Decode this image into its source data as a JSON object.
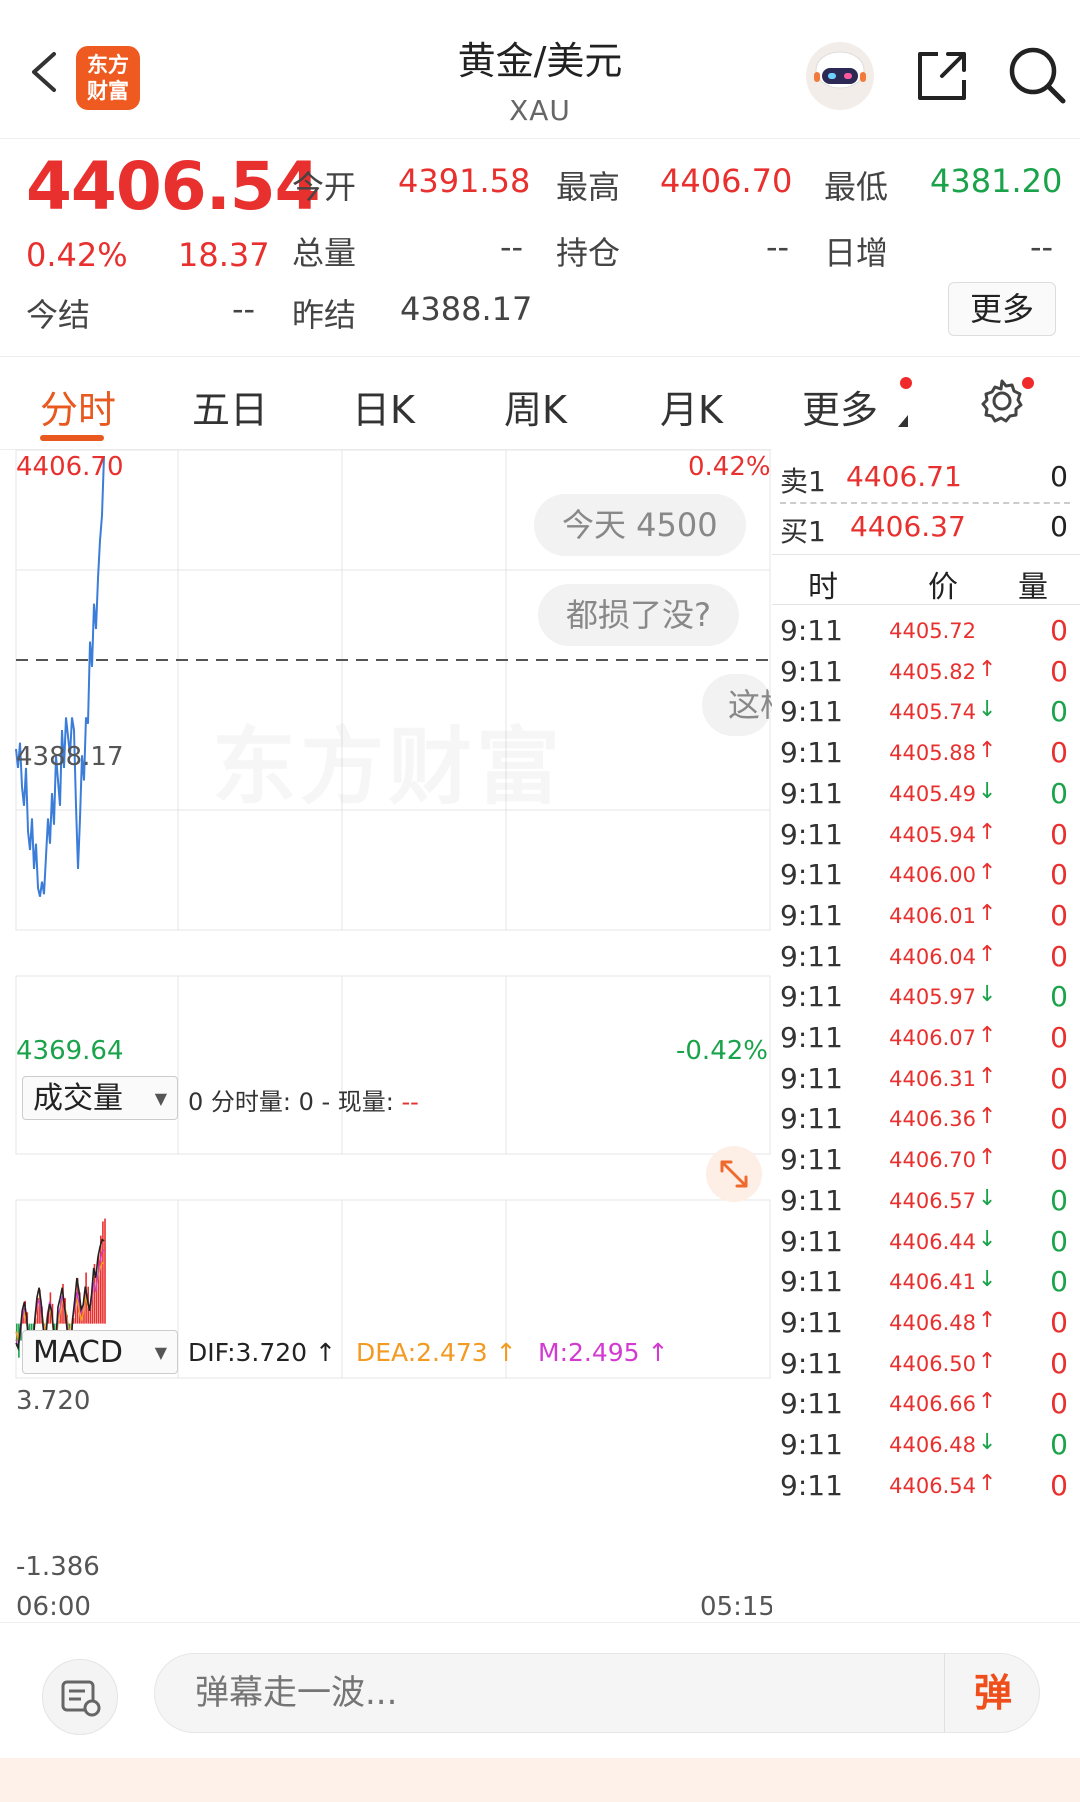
{
  "header": {
    "title": "黄金/美元",
    "subtitle": "XAU",
    "logo_text_line1": "东方",
    "logo_text_line2": "财富"
  },
  "quote": {
    "price": "4406.54",
    "change_pct": "0.42%",
    "change": "18.37",
    "open_label": "今开",
    "open": "4391.58",
    "high_label": "最高",
    "high": "4406.70",
    "low_label": "最低",
    "low": "4381.20",
    "volume_label": "总量",
    "volume": "--",
    "position_label": "持仓",
    "position": "--",
    "daily_inc_label": "日增",
    "daily_inc": "--",
    "settle_label": "今结",
    "settle": "--",
    "prev_settle_label": "昨结",
    "prev_settle": "4388.17",
    "more_label": "更多"
  },
  "tabs": [
    {
      "label": "分时"
    },
    {
      "label": "五日"
    },
    {
      "label": "日K"
    },
    {
      "label": "周K"
    },
    {
      "label": "月K"
    },
    {
      "label": "更多"
    }
  ],
  "chart": {
    "top_price": "4406.70",
    "top_pct": "0.42%",
    "mid_price": "4388.17",
    "bottom_price": "4369.64",
    "bottom_pct": "-0.42%",
    "watermark": "东方财富",
    "bubbles": [
      "今天 4500",
      "都损了没?",
      "这株"
    ],
    "volume_selector": "成交量",
    "volume_info": "0 分时量: 0 - 现量: ",
    "volume_now": "--",
    "macd_selector": "MACD",
    "dif": "DIF:3.720 ↑",
    "dea": "DEA:2.473 ↑",
    "m": "M:2.495 ↑",
    "macd_top": "3.720",
    "macd_bottom": "-1.386",
    "time_start": "06:00",
    "time_end": "05:15"
  },
  "orderbook": {
    "sell_label": "卖1",
    "sell_price": "4406.71",
    "sell_vol": "0",
    "buy_label": "买1",
    "buy_price": "4406.37",
    "buy_vol": "0",
    "col_time": "时",
    "col_price": "价",
    "col_vol": "量"
  },
  "ticks": [
    {
      "t": "9:11",
      "p": "4405.72",
      "a": "",
      "v": "0",
      "c": "red"
    },
    {
      "t": "9:11",
      "p": "4405.82",
      "a": "↑",
      "v": "0",
      "c": "red"
    },
    {
      "t": "9:11",
      "p": "4405.74",
      "a": "↓",
      "v": "0",
      "c": "green"
    },
    {
      "t": "9:11",
      "p": "4405.88",
      "a": "↑",
      "v": "0",
      "c": "red"
    },
    {
      "t": "9:11",
      "p": "4405.49",
      "a": "↓",
      "v": "0",
      "c": "green"
    },
    {
      "t": "9:11",
      "p": "4405.94",
      "a": "↑",
      "v": "0",
      "c": "red"
    },
    {
      "t": "9:11",
      "p": "4406.00",
      "a": "↑",
      "v": "0",
      "c": "red"
    },
    {
      "t": "9:11",
      "p": "4406.01",
      "a": "↑",
      "v": "0",
      "c": "red"
    },
    {
      "t": "9:11",
      "p": "4406.04",
      "a": "↑",
      "v": "0",
      "c": "red"
    },
    {
      "t": "9:11",
      "p": "4405.97",
      "a": "↓",
      "v": "0",
      "c": "green"
    },
    {
      "t": "9:11",
      "p": "4406.07",
      "a": "↑",
      "v": "0",
      "c": "red"
    },
    {
      "t": "9:11",
      "p": "4406.31",
      "a": "↑",
      "v": "0",
      "c": "red"
    },
    {
      "t": "9:11",
      "p": "4406.36",
      "a": "↑",
      "v": "0",
      "c": "red"
    },
    {
      "t": "9:11",
      "p": "4406.70",
      "a": "↑",
      "v": "0",
      "c": "red"
    },
    {
      "t": "9:11",
      "p": "4406.57",
      "a": "↓",
      "v": "0",
      "c": "green"
    },
    {
      "t": "9:11",
      "p": "4406.44",
      "a": "↓",
      "v": "0",
      "c": "green"
    },
    {
      "t": "9:11",
      "p": "4406.41",
      "a": "↓",
      "v": "0",
      "c": "green"
    },
    {
      "t": "9:11",
      "p": "4406.48",
      "a": "↑",
      "v": "0",
      "c": "red"
    },
    {
      "t": "9:11",
      "p": "4406.50",
      "a": "↑",
      "v": "0",
      "c": "red"
    },
    {
      "t": "9:11",
      "p": "4406.66",
      "a": "↑",
      "v": "0",
      "c": "red"
    },
    {
      "t": "9:11",
      "p": "4406.48",
      "a": "↓",
      "v": "0",
      "c": "green"
    },
    {
      "t": "9:11",
      "p": "4406.54",
      "a": "↑",
      "v": "0",
      "c": "red"
    }
  ],
  "bottom": {
    "input_placeholder": "弹幕走一波...",
    "danmu_button": "弹"
  },
  "colors": {
    "up": "#e8302e",
    "down": "#1aa34a",
    "accent": "#e8581f"
  }
}
